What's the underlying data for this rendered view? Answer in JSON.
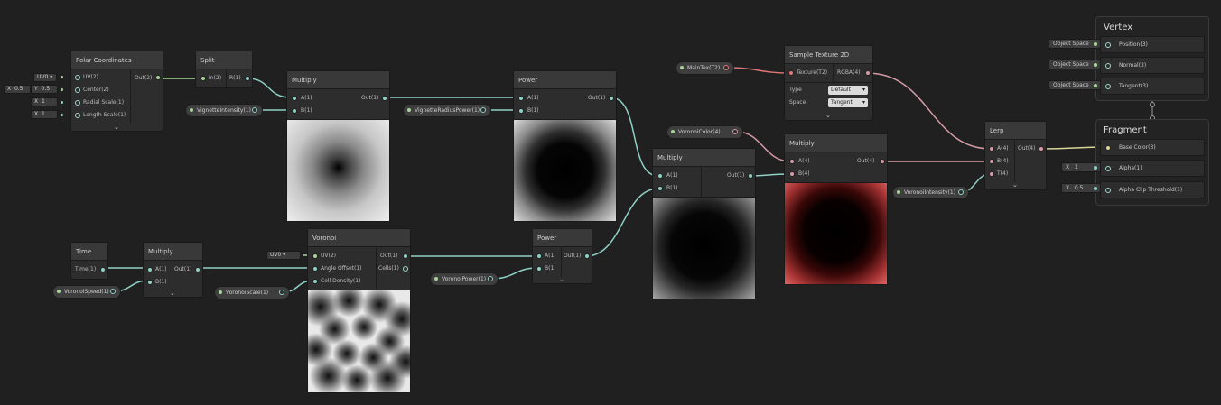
{
  "nodes": {
    "polar": {
      "title": "Polar Coordinates",
      "inputs": [
        "UV(2)",
        "Center(2)",
        "Radial Scale(1)",
        "Length Scale(1)"
      ],
      "output": "Out(2)",
      "uv_dropdown": "UV0",
      "center_x_label": "X",
      "center_x": "0.5",
      "center_y_label": "Y",
      "center_y": "0.5",
      "radial_label": "X",
      "radial": "1",
      "length_label": "X",
      "length": "1"
    },
    "split": {
      "title": "Split",
      "input": "In(2)",
      "output": "R(1)"
    },
    "multiply1": {
      "title": "Multiply",
      "inputs": [
        "A(1)",
        "B(1)"
      ],
      "output": "Out(1)"
    },
    "power1": {
      "title": "Power",
      "inputs": [
        "A(1)",
        "B(1)"
      ],
      "output": "Out(1)"
    },
    "multiply2": {
      "title": "Multiply",
      "inputs": [
        "A(1)",
        "B(1)"
      ],
      "output": "Out(1)"
    },
    "sample": {
      "title": "Sample Texture 2D",
      "input": "Texture(T2)",
      "output": "RGBA(4)",
      "type_label": "Type",
      "type_value": "Default",
      "space_label": "Space",
      "space_value": "Tangent"
    },
    "multiply3": {
      "title": "Multiply",
      "inputs": [
        "A(4)",
        "B(4)"
      ],
      "output": "Out(4)"
    },
    "lerp": {
      "title": "Lerp",
      "inputs": [
        "A(4)",
        "B(4)",
        "T(4)"
      ],
      "output": "Out(4)"
    },
    "time": {
      "title": "Time",
      "output": "Time(1)"
    },
    "multiply4": {
      "title": "Multiply",
      "inputs": [
        "A(1)",
        "B(1)"
      ],
      "output": "Out(1)"
    },
    "voronoi": {
      "title": "Voronoi",
      "inputs": [
        "UV(2)",
        "Angle Offset(1)",
        "Cell Density(1)"
      ],
      "outputs": [
        "Out(1)",
        "Cells(1)"
      ],
      "uv_dropdown": "UV0"
    },
    "power2": {
      "title": "Power",
      "inputs": [
        "A(1)",
        "B(1)"
      ],
      "output": "Out(1)"
    }
  },
  "properties": {
    "vignette_intensity": "VignetteIntensity(1)",
    "vignette_radius_power": "VignetteRadiusPower(1)",
    "main_tex": "MainTex(T2)",
    "voronoi_color": "VoronoiColor(4)",
    "voronoi_intensity": "VoronoiIntensity(1)",
    "voronoi_speed": "VoronoiSpeed(1)",
    "voronoi_scale": "VoronoiScale(1)",
    "voronoi_power": "VoronoiPower(1)"
  },
  "master": {
    "vertex_title": "Vertex",
    "vertex_slots": [
      "Position(3)",
      "Normal(3)",
      "Tangent(3)"
    ],
    "vertex_tags": [
      "Object Space",
      "Object Space",
      "Object Space"
    ],
    "fragment_title": "Fragment",
    "fragment_slots": [
      "Base Color(3)",
      "Alpha(1)",
      "Alpha Clip Threshold(1)"
    ],
    "alpha_label": "X",
    "alpha_value": "1",
    "clip_label": "X",
    "clip_value": "0.5"
  },
  "colors": {
    "background": "#202020",
    "float_wire": "#8fd1c6",
    "vector4_wire": "#d49aa6",
    "texture_wire": "#e07676",
    "vector3_wire": "#d8d49a",
    "vector2_wire": "#a8d49a"
  },
  "icons": {
    "expand": "chevron-down-icon",
    "port": "port-dot-icon"
  }
}
